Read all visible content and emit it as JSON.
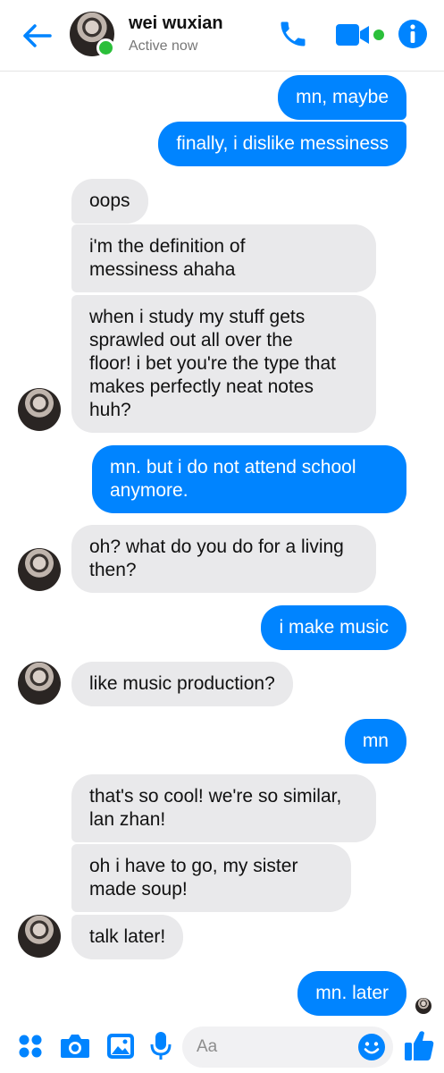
{
  "header": {
    "contact_name": "wei wuxian",
    "status": "Active now"
  },
  "colors": {
    "accent": "#0084ff",
    "incoming_bubble": "#e9e9eb",
    "online": "#2bbf3a"
  },
  "messages": [
    {
      "dir": "out",
      "text": "mn, maybe"
    },
    {
      "dir": "out",
      "text": "finally, i dislike messiness"
    },
    {
      "dir": "in",
      "text": "oops"
    },
    {
      "dir": "in",
      "text": "i'm the definition of\nmessiness ahaha"
    },
    {
      "dir": "in",
      "text": "when i study my stuff gets\nsprawled out all over the\nfloor! i bet you're the type that\nmakes perfectly neat notes\nhuh?"
    },
    {
      "dir": "out",
      "text": "mn. but i do not attend school\nanymore."
    },
    {
      "dir": "in",
      "text": "oh? what do you do for a living\nthen?"
    },
    {
      "dir": "out",
      "text": "i make music"
    },
    {
      "dir": "in",
      "text": "like music production?"
    },
    {
      "dir": "out",
      "text": "mn"
    },
    {
      "dir": "in",
      "text": "that's so cool! we're so similar,\nlan zhan!"
    },
    {
      "dir": "in",
      "text": "oh i have to go, my sister\nmade soup!"
    },
    {
      "dir": "in",
      "text": "talk later!"
    },
    {
      "dir": "out",
      "text": "mn. later"
    }
  ],
  "composer": {
    "placeholder": "Aa"
  },
  "icons": {
    "back": "arrow-left-icon",
    "call": "phone-icon",
    "video": "video-camera-icon",
    "info": "info-icon",
    "more": "four-dots-icon",
    "camera": "camera-icon",
    "gallery": "image-icon",
    "voice": "microphone-icon",
    "emoji": "emoji-icon",
    "like": "thumbs-up-icon"
  }
}
